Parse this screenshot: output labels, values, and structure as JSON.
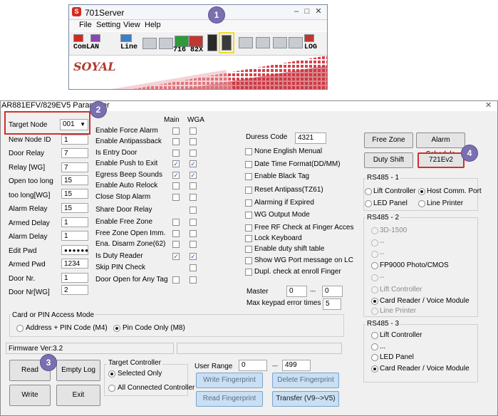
{
  "colors": {
    "badge": "#7a6fb0",
    "highlight_red": "#d0302c",
    "highlight_yellow": "#f2dc2a",
    "button_blue": "#c9dff3",
    "brand_red": "#b03a2e"
  },
  "server_window": {
    "title": "701Server",
    "menu": [
      "File",
      "Setting",
      "View",
      "Help"
    ],
    "toolbar": {
      "comlan": "ComLAN",
      "line": "Line",
      "nums": "716 82X",
      "log": "LOG"
    },
    "brand": "SOYAL"
  },
  "badges": [
    "1",
    "2",
    "3",
    "4"
  ],
  "param_window": {
    "title": "AR881EFV/829EV5 Parameter",
    "close": "✕",
    "left_fields": [
      {
        "label": "Target Node",
        "value": "001"
      },
      {
        "label": "New Node ID",
        "value": "1"
      },
      {
        "label": "Door Relay",
        "value": "7"
      },
      {
        "label": "Relay [WG]",
        "value": "7"
      },
      {
        "label": "Open too long",
        "value": "15"
      },
      {
        "label": "too long[WG]",
        "value": "15"
      },
      {
        "label": "Alarm Relay",
        "value": "15"
      },
      {
        "label": "Armed Delay",
        "value": "1"
      },
      {
        "label": "Alarm Delay",
        "value": "1"
      },
      {
        "label": "Edit Pwd",
        "value": "●●●●●●"
      },
      {
        "label": "Armed Pwd",
        "value": "1234"
      },
      {
        "label": "Door Nr.",
        "value": "1"
      },
      {
        "label": "Door Nr[WG]",
        "value": "2"
      }
    ],
    "col_main": "Main",
    "col_wga": "WGA",
    "options": [
      {
        "label": "Enable Force Alarm",
        "main": false,
        "wga": false
      },
      {
        "label": "Enable Antipassback",
        "main": false,
        "wga": false
      },
      {
        "label": "Is Entry Door",
        "main": false,
        "wga": false
      },
      {
        "label": "Enable Push to Exit",
        "main": true,
        "wga": true
      },
      {
        "label": "Egress Beep Sounds",
        "main": true,
        "wga": true
      },
      {
        "label": "Enable Auto Relock",
        "main": false,
        "wga": false
      },
      {
        "label": "Close Stop Alarm",
        "main": false,
        "wga": false
      },
      {
        "label": "Share Door Relay",
        "main": null,
        "wga": false
      },
      {
        "label": "Enable Free Zone",
        "main": false,
        "wga": false
      },
      {
        "label": "Free Zone Open Imm.",
        "main": false,
        "wga": false
      },
      {
        "label": "Ena. Disarm Zone(62)",
        "main": false,
        "wga": false
      },
      {
        "label": "Is Duty Reader",
        "main": true,
        "wga": true
      },
      {
        "label": "Skip PIN Check",
        "main": null,
        "wga": false
      },
      {
        "label": "Door Open for Any Tag",
        "main": false,
        "wga": false
      }
    ],
    "duress": {
      "label": "Duress Code",
      "value": "4321"
    },
    "right_checks": [
      {
        "label": "None English Menual",
        "checked": false
      },
      {
        "label": "Date Time Format(DD/MM)",
        "checked": false
      },
      {
        "label": "Enable Black Tag",
        "checked": false
      },
      {
        "label": "Reset Antipass(TZ61)",
        "checked": false
      },
      {
        "label": "Alarming if Expired",
        "checked": false
      },
      {
        "label": "WG Output Mode",
        "checked": false
      },
      {
        "label": "Free RF Check at Finger Acces",
        "checked": false
      },
      {
        "label": "Lock Keyboard",
        "checked": false
      },
      {
        "label": "Enable duty shift table",
        "checked": false
      },
      {
        "label": "Show WG Port message on LC",
        "checked": false
      },
      {
        "label": "Dupl. check at enroll  Finger",
        "checked": false
      }
    ],
    "master": {
      "label": "Master",
      "from": "0",
      "sep": "---",
      "to": "0"
    },
    "keypad": {
      "label": "Max keypad error times",
      "value": "5"
    },
    "buttons_right": {
      "free_zone": "Free Zone",
      "alarm_schedule": "Alarm Schedule",
      "duty_shift": "Duty Shift",
      "ev2": "721Ev2"
    },
    "rs485_1": {
      "title": "RS485 - 1",
      "options": [
        {
          "label": "Lift Controller",
          "on": false
        },
        {
          "label": "Host Comm. Port",
          "on": true
        },
        {
          "label": "LED Panel",
          "on": false
        },
        {
          "label": "Line Printer",
          "on": false
        }
      ]
    },
    "rs485_2": {
      "title": "RS485 - 2",
      "options": [
        {
          "label": "3D-1500",
          "on": false,
          "dis": true
        },
        {
          "label": "--",
          "on": false,
          "dis": true
        },
        {
          "label": "--",
          "on": false,
          "dis": true
        },
        {
          "label": "FP9000 Photo/CMOS",
          "on": false,
          "dis": false
        },
        {
          "label": "--",
          "on": false,
          "dis": true
        },
        {
          "label": "Lift Controller",
          "on": false,
          "dis": true
        },
        {
          "label": "Card Reader / Voice Module",
          "on": true,
          "dis": false
        },
        {
          "label": "Line Printer",
          "on": false,
          "dis": true
        }
      ]
    },
    "rs485_3": {
      "title": "RS485 - 3",
      "options": [
        {
          "label": "Lift Controller",
          "on": false
        },
        {
          "label": "...",
          "on": false
        },
        {
          "label": "LED Panel",
          "on": false
        },
        {
          "label": "Card Reader / Voice Module",
          "on": true
        }
      ]
    },
    "access_mode": {
      "title": "Card or PIN Access Mode",
      "opt1": "Address + PIN Code (M4)",
      "opt2": "Pin Code Only (M8)"
    },
    "firmware": "Firmware Ver:3.2",
    "buttons_bottom": {
      "read": "Read",
      "empty_log": "Empty Log",
      "write": "Write",
      "exit": "Exit"
    },
    "target_controller": {
      "title": "Target Controller",
      "opt1": "Selected Only",
      "opt2": "All Connected Controller"
    },
    "user_range": {
      "label": "User Range",
      "from": "0",
      "sep": "---",
      "to": "499"
    },
    "fp_buttons": {
      "write_fp": "Write Fingerprint",
      "delete_fp": "Delete Fingerprint",
      "read_fp": "Read Fingerprint",
      "transfer": "Transfer (V9-->V5)"
    }
  }
}
